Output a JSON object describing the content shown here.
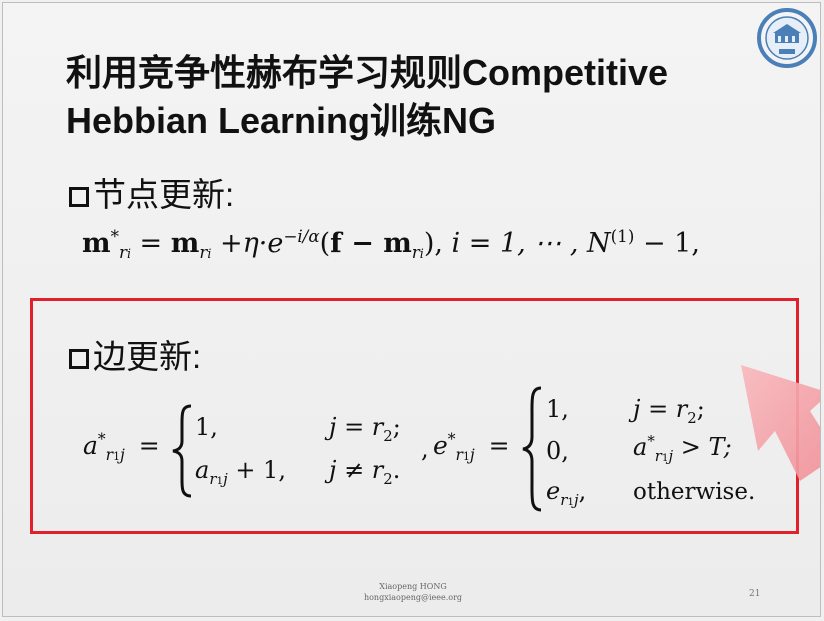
{
  "title": {
    "line1": "利用竞争性赫布学习规则Competitive",
    "line2": "Hebbian Learning训练NG"
  },
  "sections": {
    "node_update": "节点更新:",
    "edge_update": "边更新:"
  },
  "equation1": {
    "lhs_m": "m",
    "lhs_sub": "r",
    "lhs_sub_i": "i",
    "lhs_star": "*",
    "eq": " = ",
    "m": "m",
    "sub_r": "r",
    "sub_i": "i",
    "plus_eta": " +η·e",
    "exp": "−i/α",
    "paren_open": "(",
    "f": "f",
    "minus_m": " − m",
    "sub_r2": "r",
    "sub_i2": "i",
    "paren_close": "), ",
    "i_range": "i = 1, ⋯ , N",
    "N_sup": "(1)",
    "tail": " − 1,"
  },
  "equation2": {
    "a_lhs": "a",
    "a_lhs_star": "*",
    "a_lhs_sub": "r",
    "a_lhs_sub1": "1",
    "a_lhs_j": "j",
    "eq": "=",
    "case1_val": "1,",
    "case1_cond": "j = r",
    "case1_cond_sub": "2",
    "case1_end": ";",
    "case2_val_a": "a",
    "case2_val_sub": "r",
    "case2_val_sub1": "1",
    "case2_val_j": "j",
    "case2_val_tail": " + 1,",
    "case2_cond": "j ≠ r",
    "case2_cond_sub": "2",
    "case2_end": ".",
    "comma": ",",
    "e_lhs": "e",
    "e_lhs_star": "*",
    "e_lhs_sub": "r",
    "e_lhs_sub1": "1",
    "e_lhs_j": "j",
    "e_case1_val": "1,",
    "e_case1_cond": "j = r",
    "e_case1_cond_sub": "2",
    "e_case1_end": ";",
    "e_case2_val": "0,",
    "e_case2_cond_a": "a",
    "e_case2_cond_star": "*",
    "e_case2_cond_sub": "r",
    "e_case2_cond_sub1": "1",
    "e_case2_cond_j": "j",
    "e_case2_cond_tail": " > T;",
    "e_case3_val_e": "e",
    "e_case3_val_sub": "r",
    "e_case3_val_sub1": "1",
    "e_case3_val_j": "j",
    "e_case3_val_comma": ",",
    "e_case3_cond": "otherwise."
  },
  "footer": {
    "author": "Xiaopeng HONG",
    "email": "hongxiaopeng@ieee.org",
    "page": "21"
  },
  "colors": {
    "highlight_box": "#e0202a",
    "arrow": "#f4a0a6"
  }
}
